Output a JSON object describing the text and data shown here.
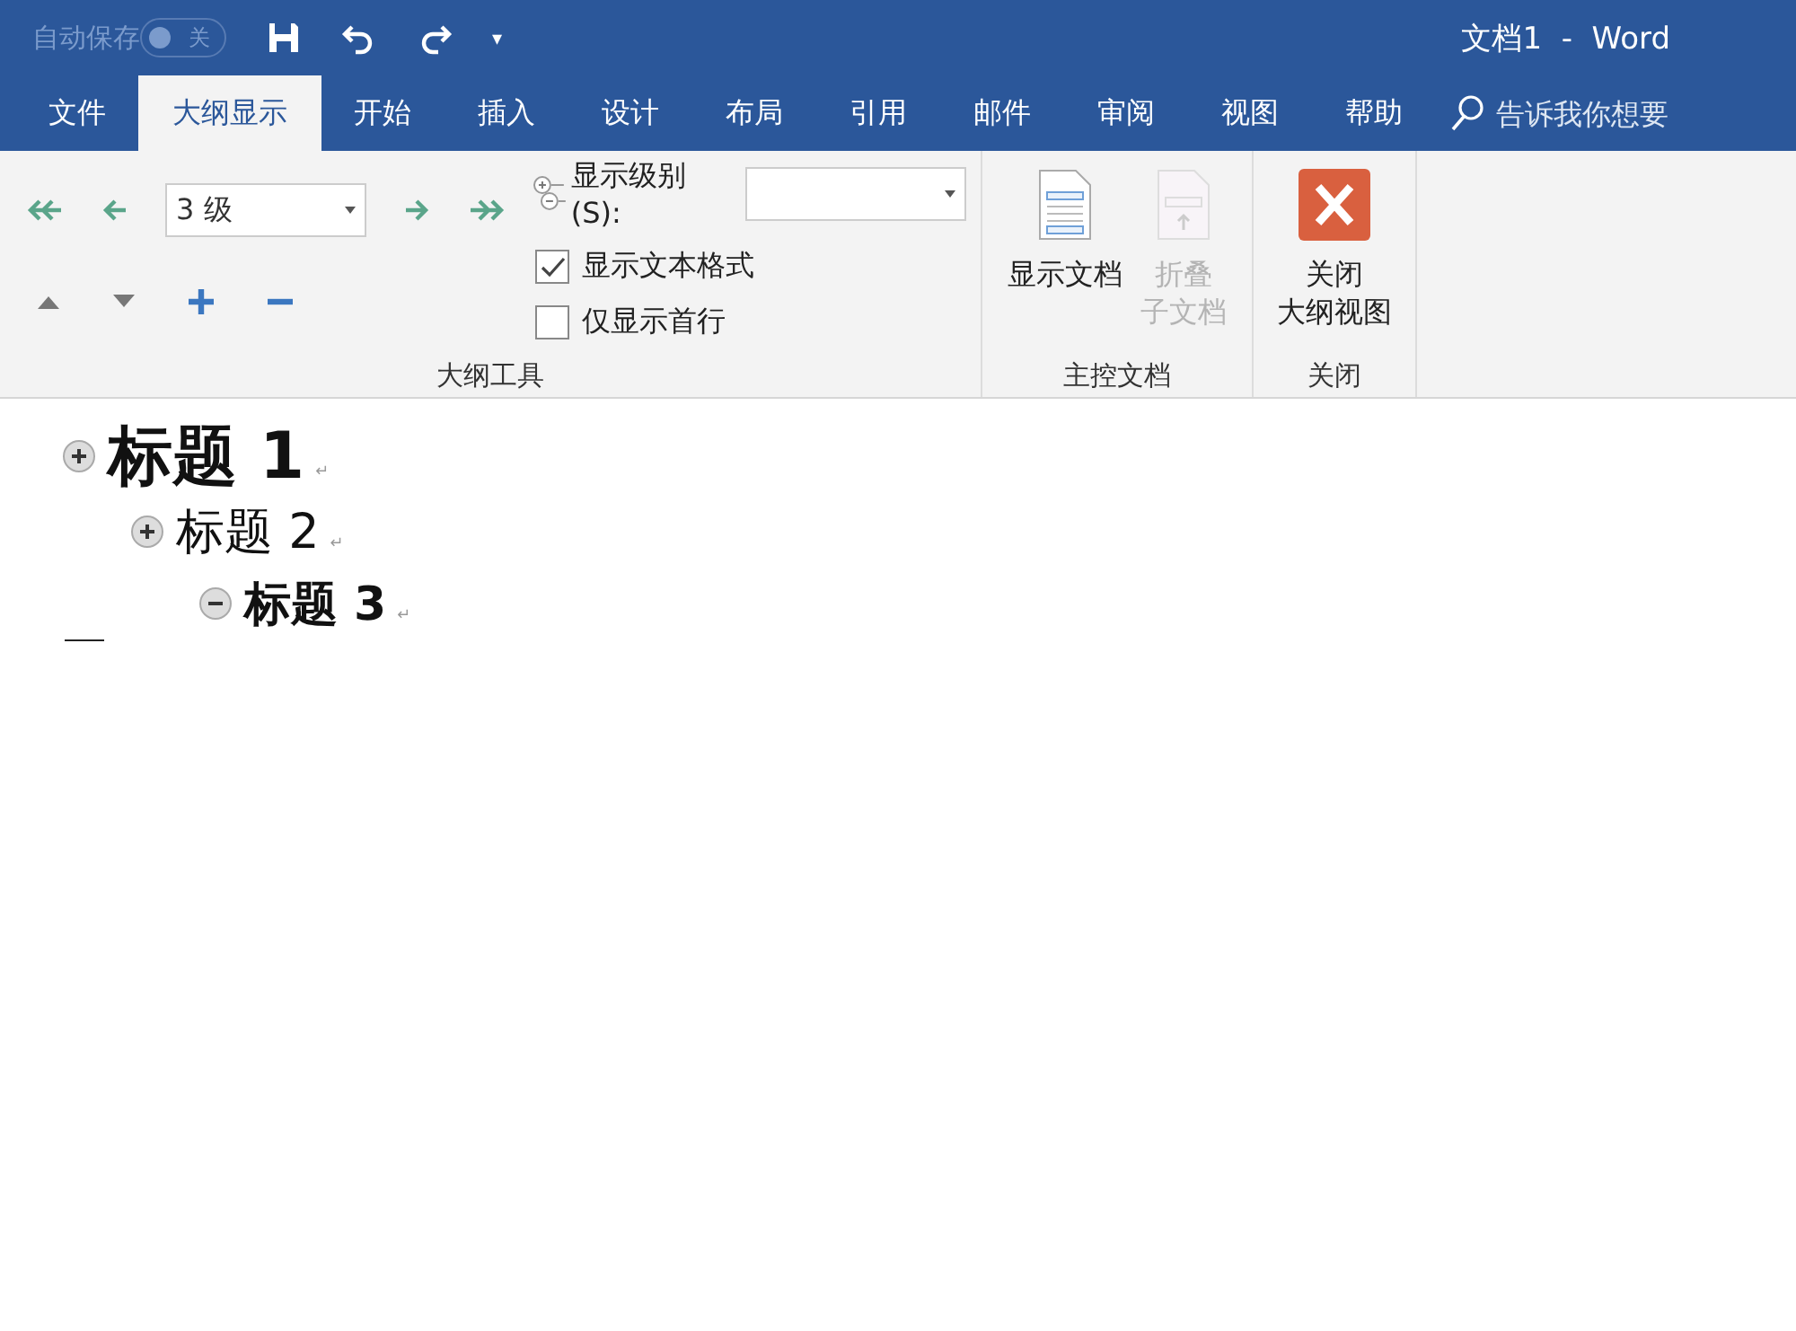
{
  "window": {
    "title": "文档1  -  Word"
  },
  "quick_access": {
    "autosave_label": "自动保存",
    "autosave_toggle": {
      "label": "关",
      "on": false
    },
    "customize_caret": "▾"
  },
  "tabs": [
    {
      "label": "文件",
      "selected": false
    },
    {
      "label": "大纲显示",
      "selected": true
    },
    {
      "label": "开始",
      "selected": false
    },
    {
      "label": "插入",
      "selected": false
    },
    {
      "label": "设计",
      "selected": false
    },
    {
      "label": "布局",
      "selected": false
    },
    {
      "label": "引用",
      "selected": false
    },
    {
      "label": "邮件",
      "selected": false
    },
    {
      "label": "审阅",
      "selected": false
    },
    {
      "label": "视图",
      "selected": false
    },
    {
      "label": "帮助",
      "selected": false
    }
  ],
  "tell_me": {
    "placeholder": "告诉我你想要"
  },
  "outline_tools": {
    "level_dropdown": {
      "value": "3 级"
    },
    "show_level": {
      "label": "显示级别(S):"
    },
    "checkboxes": [
      {
        "label": "显示文本格式",
        "checked": true
      },
      {
        "label": "仅显示首行",
        "checked": false
      }
    ],
    "group_label": "大纲工具"
  },
  "master_document": {
    "buttons": [
      {
        "lines": [
          "显示文档"
        ],
        "disabled": false
      },
      {
        "lines": [
          "折叠",
          "子文档"
        ],
        "disabled": true
      }
    ],
    "group_label": "主控文档"
  },
  "close_group": {
    "button_lines": [
      "关闭",
      "大纲视图"
    ],
    "group_label": "关闭"
  },
  "outline": [
    {
      "text": "标题 1",
      "mark": "↵",
      "expandable": true,
      "children": [
        {
          "text": "标题 2",
          "mark": "↵",
          "expandable": true,
          "children": [
            {
              "text": "标题 3",
              "mark": "↵",
              "expandable": false
            }
          ]
        }
      ]
    }
  ]
}
